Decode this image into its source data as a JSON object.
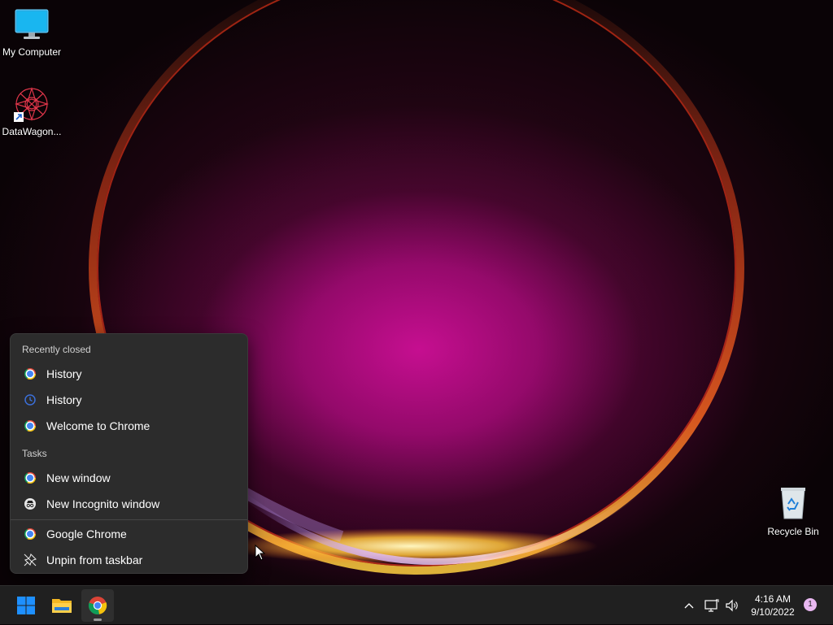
{
  "desktop": {
    "icons": [
      {
        "label": "My Computer",
        "icon": "monitor-icon"
      },
      {
        "label": "DataWagon...",
        "icon": "datawagon-shortcut-icon"
      },
      {
        "label": "Recycle Bin",
        "icon": "recycle-bin-icon"
      }
    ]
  },
  "jumplist": {
    "recent_header": "Recently closed",
    "recent_items": [
      {
        "label": "History",
        "icon": "chrome-icon"
      },
      {
        "label": "History",
        "icon": "history-clock-icon"
      },
      {
        "label": "Welcome to Chrome",
        "icon": "chrome-icon"
      }
    ],
    "tasks_header": "Tasks",
    "task_items": [
      {
        "label": "New window",
        "icon": "chrome-icon"
      },
      {
        "label": "New Incognito window",
        "icon": "incognito-icon"
      }
    ],
    "app_items": [
      {
        "label": "Google Chrome",
        "icon": "chrome-icon"
      },
      {
        "label": "Unpin from taskbar",
        "icon": "unpin-icon"
      }
    ]
  },
  "taskbar": {
    "pinned": [
      {
        "name": "start",
        "icon": "windows-start-icon"
      },
      {
        "name": "file-explorer",
        "icon": "folder-icon"
      },
      {
        "name": "chrome",
        "icon": "chrome-icon",
        "active": true
      }
    ],
    "tray": {
      "icons": [
        "chevron-up-icon",
        "network-icon",
        "volume-icon"
      ],
      "time": "4:16 AM",
      "date": "9/10/2022",
      "notification_count": "1"
    }
  },
  "colors": {
    "taskbar_bg": "#202020",
    "menu_bg": "#2c2c2c",
    "wallpaper_glow": "#c8108f",
    "windows_blue": "#1e90ff"
  }
}
